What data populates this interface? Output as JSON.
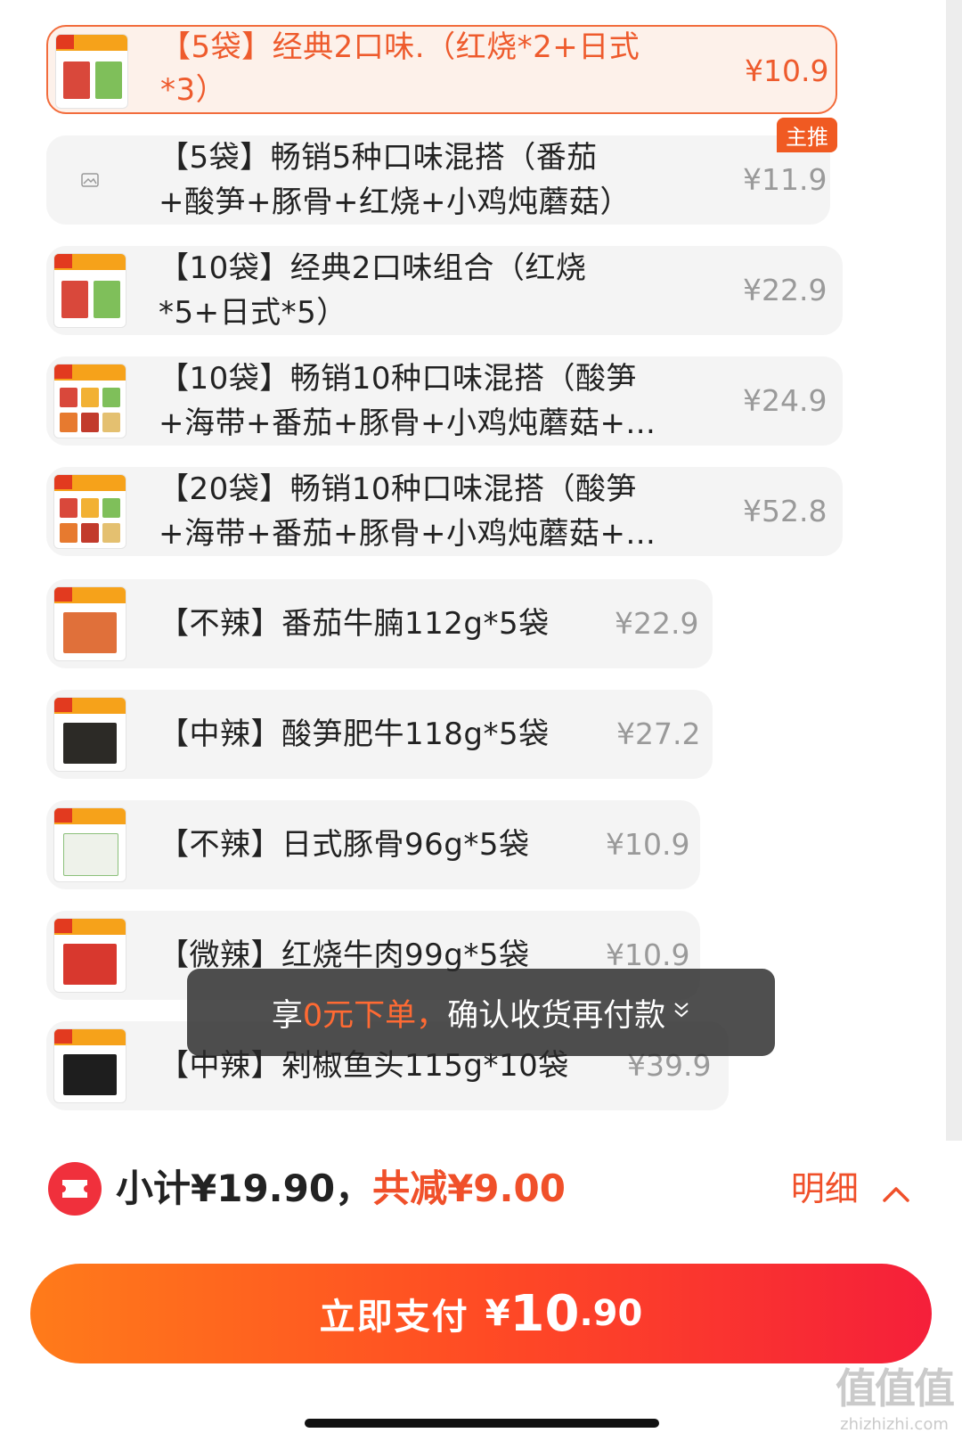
{
  "skus": [
    {
      "text_line1": "【5袋】经典2口味.（红烧*2+日式",
      "text_line2": "*3）",
      "price": "¥10.9",
      "selected": true
    },
    {
      "text_line1": "【5袋】畅销5种口味混搭（番茄",
      "text_line2": "+酸笋+豚骨+红烧+小鸡炖蘑菇）",
      "price": "¥11.9",
      "badge": "主推",
      "thumb": "image-placeholder-icon"
    },
    {
      "text_line1": "【10袋】经典2口味组合（红烧",
      "text_line2": "*5+日式*5）",
      "price": "¥22.9"
    },
    {
      "text_line1": "【10袋】畅销10种口味混搭（酸笋",
      "text_line2": "+海带+番茄+豚骨+小鸡炖蘑菇+...",
      "price": "¥24.9"
    },
    {
      "text_line1": "【20袋】畅销10种口味混搭（酸笋",
      "text_line2": "+海带+番茄+豚骨+小鸡炖蘑菇+...",
      "price": "¥52.8"
    },
    {
      "text_line1": "【不辣】番茄牛腩112g*5袋",
      "price": "¥22.9"
    },
    {
      "text_line1": "【中辣】酸笋肥牛118g*5袋",
      "price": "¥27.2"
    },
    {
      "text_line1": "【不辣】日式豚骨96g*5袋",
      "price": "¥10.9"
    },
    {
      "text_line1": "【微辣】红烧牛肉99g*5袋",
      "price": "¥10.9"
    },
    {
      "text_line1": "【中辣】剁椒鱼头115g*10袋",
      "price": "¥39.9"
    }
  ],
  "toast": {
    "prefix": "享",
    "highlight": "0元下单，",
    "suffix": "确认收货再付款",
    "icon": "chevron-down-icon"
  },
  "footer": {
    "subtotal": "小计¥19.90，",
    "discount": "共减¥9.00",
    "detail": "明细",
    "detail_icon": "chevron-up-icon",
    "coupon_icon": "coupon-icon"
  },
  "pay_button": {
    "label": "立即支付",
    "yen": "¥",
    "integer": "10",
    "decimal": ".90"
  },
  "watermark": {
    "big": "值值值",
    "small": "zhizhizhi.com"
  },
  "colors": {
    "accent": "#f0502a",
    "selected_border": "#f26c3c",
    "badge": "#f05a22",
    "pay_start": "#ff7b1a",
    "pay_end": "#f51f3a"
  }
}
